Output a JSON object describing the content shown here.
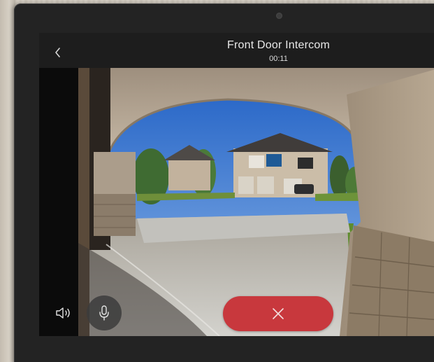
{
  "call": {
    "title": "Front Door Intercom",
    "duration": "00:11"
  },
  "controls": {
    "back_icon": "chevron-left-icon",
    "speaker_icon": "speaker-icon",
    "mic_icon": "microphone-icon",
    "hangup_icon": "close-icon"
  },
  "colors": {
    "hangup": "#c8383d",
    "top_bar": "#1e1e1e",
    "text": "#e9e9e9"
  }
}
